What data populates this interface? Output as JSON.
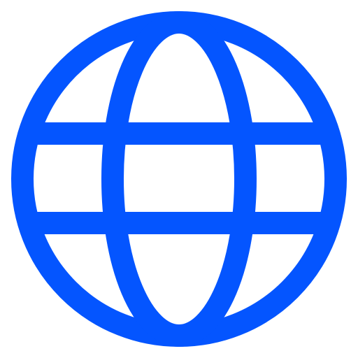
{
  "icon": {
    "name": "globe-icon",
    "color": "#0455FF",
    "background": "#FFFFFF"
  }
}
